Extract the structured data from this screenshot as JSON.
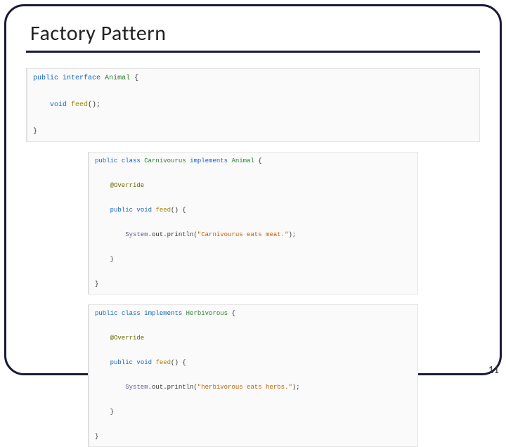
{
  "title": "Factory Pattern",
  "pageNumber": "11",
  "code1": {
    "l1a": "public",
    "l1b": "interface",
    "l1c": "Animal",
    "l1d": "{",
    "l2a": "    void",
    "l2b": "feed",
    "l2c": "();",
    "l3": "}"
  },
  "code2": {
    "l1a": "public",
    "l1b": "class",
    "l1c": "Carnivourus",
    "l1d": "implements",
    "l1e": "Animal",
    "l1f": " {",
    "l2": "    @Override",
    "l3a": "    public",
    "l3b": "void",
    "l3c": "feed",
    "l3d": "() {",
    "l4a": "        System",
    "l4b": ".out.println(",
    "l4c": "\"Carnivourus eats meat.\"",
    "l4d": ");",
    "l5": "    }",
    "l6": "}"
  },
  "code3": {
    "l1a": "public",
    "l1b": "class",
    "l1c": "implements",
    "l1d": "Herbivorous",
    "l1e": " {",
    "l2": "    @Override",
    "l3a": "    public",
    "l3b": "void",
    "l3c": "feed",
    "l3d": "() {",
    "l4a": "        System",
    "l4b": ".out.println(",
    "l4c": "\"herbivorous eats herbs.\"",
    "l4d": ");",
    "l5": "    }",
    "l6": "}"
  }
}
